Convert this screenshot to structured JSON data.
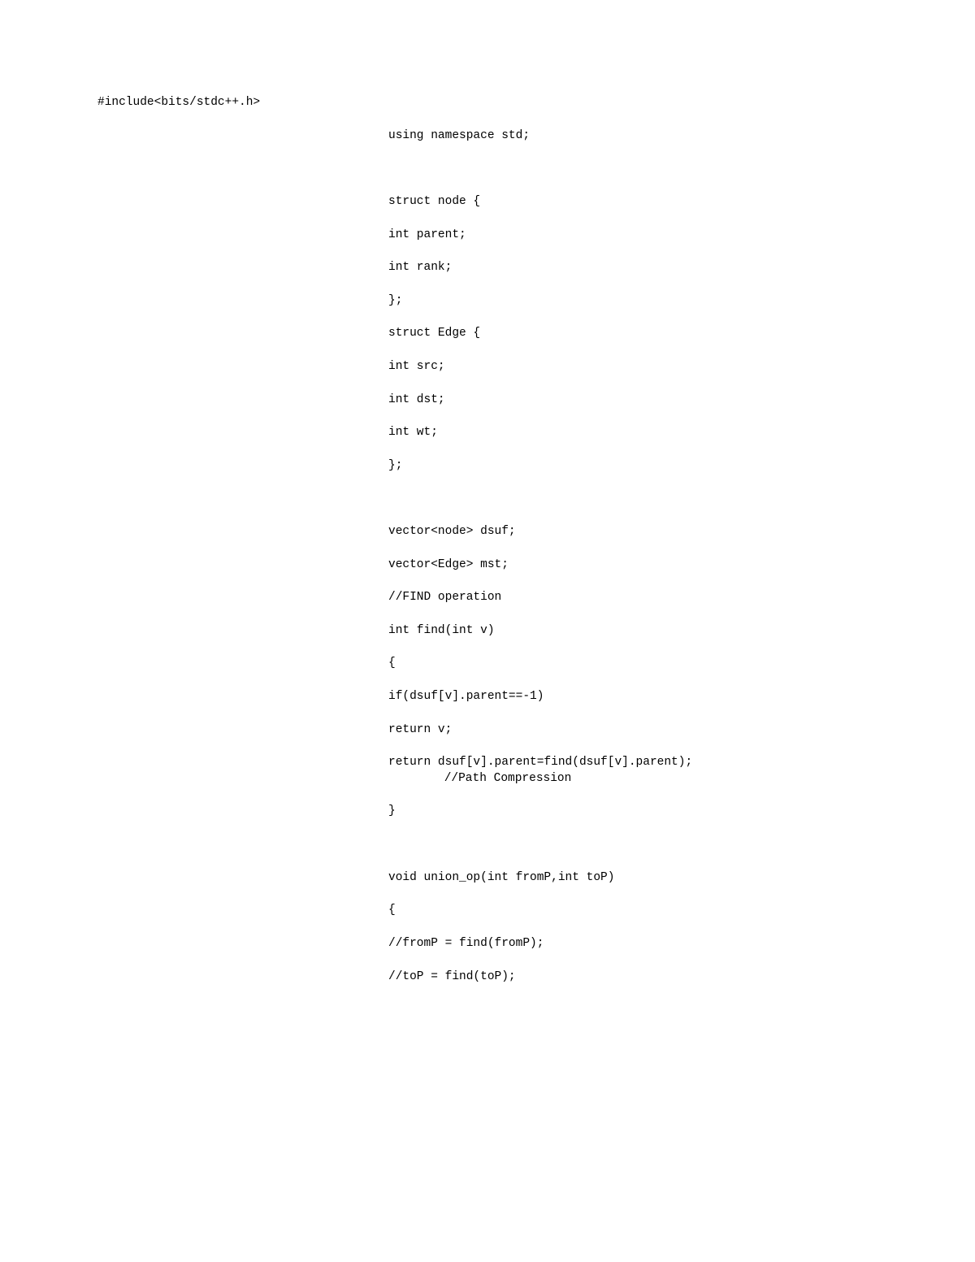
{
  "code": {
    "l1": "#include<bits/stdc++.h>",
    "l2": "using namespace std;",
    "l3": "struct node {",
    "l4": "int parent;",
    "l5": "int rank;",
    "l6": "};",
    "l7": "struct Edge {",
    "l8": "int src;",
    "l9": "int dst;",
    "l10": "int wt;",
    "l11": "};",
    "l12": "vector<node> dsuf;",
    "l13": "vector<Edge> mst;",
    "l14": "//FIND operation",
    "l15": "int find(int v)",
    "l16": "{",
    "l17": "if(dsuf[v].parent==-1)",
    "l18": "return v;",
    "l19": "return dsuf[v].parent=find(dsuf[v].parent);",
    "l19b": " //Path Compression",
    "l20": "}",
    "l21": "void union_op(int fromP,int toP)",
    "l22": "{",
    "l23": "//fromP = find(fromP);",
    "l24": "//toP = find(toP);"
  }
}
